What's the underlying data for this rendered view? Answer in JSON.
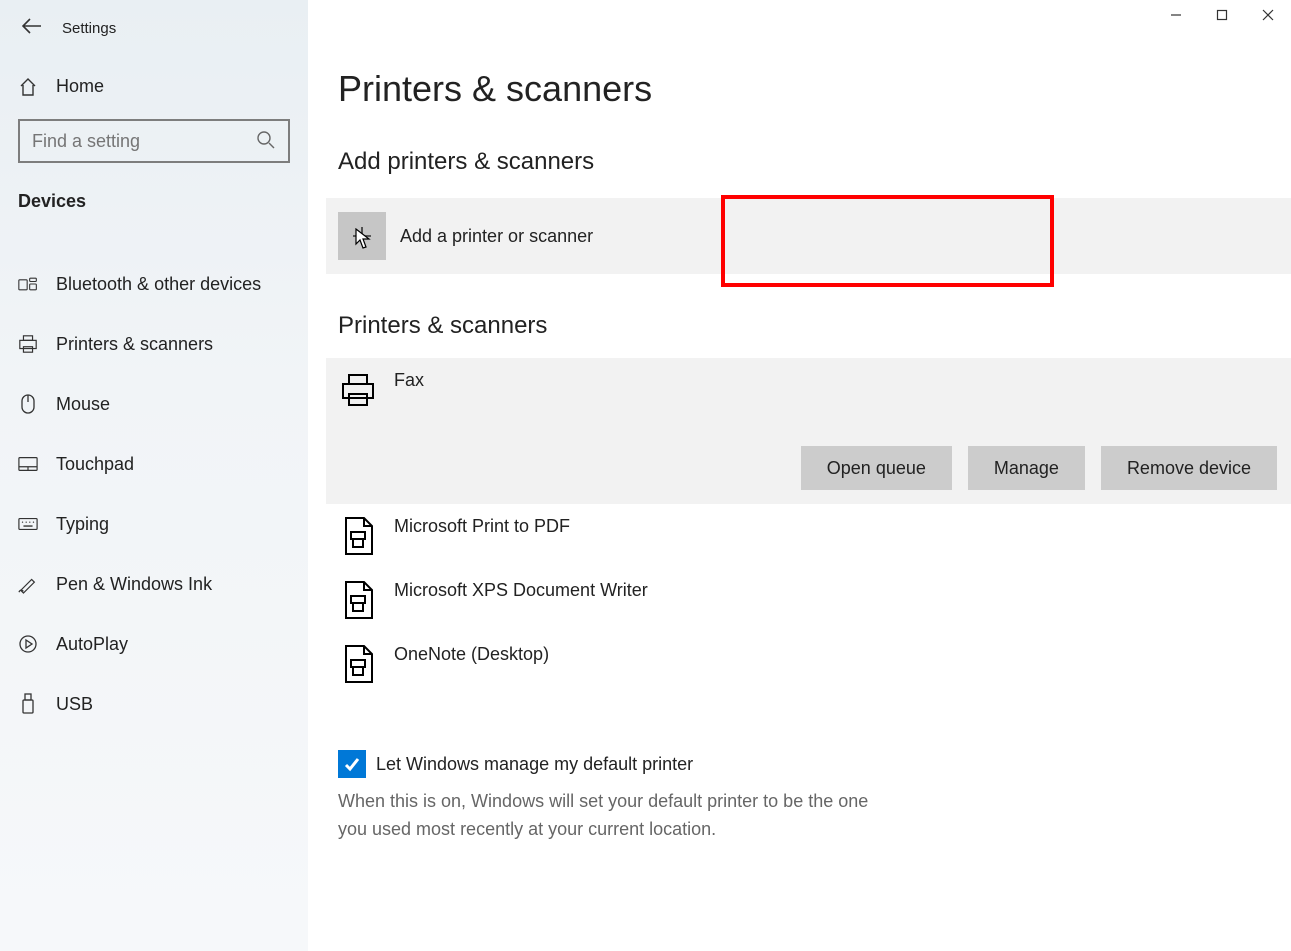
{
  "app_title": "Settings",
  "home_label": "Home",
  "search_placeholder": "Find a setting",
  "sidebar_category": "Devices",
  "nav_items": [
    {
      "label": "Bluetooth & other devices"
    },
    {
      "label": "Printers & scanners"
    },
    {
      "label": "Mouse"
    },
    {
      "label": "Touchpad"
    },
    {
      "label": "Typing"
    },
    {
      "label": "Pen & Windows Ink"
    },
    {
      "label": "AutoPlay"
    },
    {
      "label": "USB"
    }
  ],
  "page_title": "Printers & scanners",
  "section_add_title": "Add printers & scanners",
  "add_label": "Add a printer or scanner",
  "section_list_title": "Printers & scanners",
  "devices": [
    {
      "name": "Fax"
    },
    {
      "name": "Microsoft Print to PDF"
    },
    {
      "name": "Microsoft XPS Document Writer"
    },
    {
      "name": "OneNote (Desktop)"
    }
  ],
  "open_queue_label": "Open queue",
  "manage_label": "Manage",
  "remove_label": "Remove device",
  "checkbox_label": "Let Windows manage my default printer",
  "checkbox_desc": "When this is on, Windows will set your default printer to be the one you used most recently at your current location."
}
